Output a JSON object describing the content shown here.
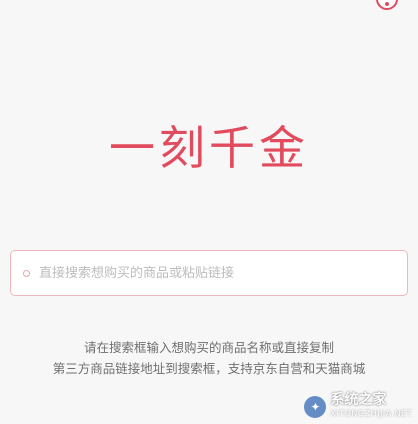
{
  "app": {
    "logo_text": "一刻千金"
  },
  "search": {
    "placeholder": "直接搜索想购买的商品或粘贴链接",
    "value": ""
  },
  "hint": {
    "line1": "请在搜索框输入想购买的商品名称或直接复制",
    "line2": "第三方商品链接地址到搜索框，支持京东自营和天猫商城"
  },
  "watermark": {
    "text": "系统之家",
    "subtext": "XITONGZHIJIA.NET"
  },
  "colors": {
    "accent": "#e24a5d",
    "search_border": "#eeb7bc",
    "background": "#f7f7f7"
  },
  "icons": {
    "corner": "help-circle-icon",
    "search": "search-ring-icon",
    "watermark": "system-home-logo-icon"
  }
}
